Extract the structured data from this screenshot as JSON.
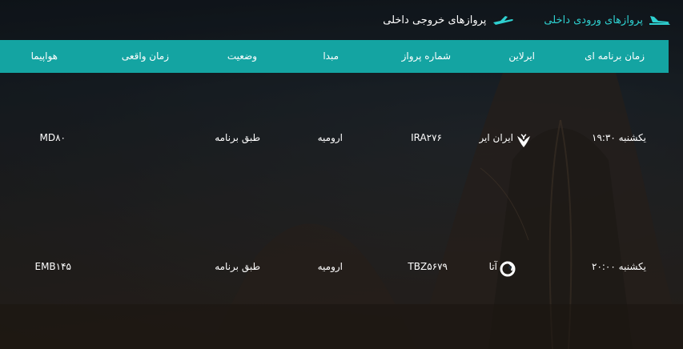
{
  "tabs": [
    {
      "label": "پروازهای ورودی داخلی",
      "icon": "plane-landing-icon",
      "active": true
    },
    {
      "label": "پروازهای خروجی داخلی",
      "icon": "plane-takeoff-icon",
      "active": false
    }
  ],
  "colors": {
    "accent": "#14a4a2",
    "active_tab": "#2ed0d0"
  },
  "columns": [
    "زمان برنامه ای",
    "ایرلاین",
    "شماره پرواز",
    "مبدا",
    "وضعیت",
    "زمان واقعی",
    "هواپیما"
  ],
  "rows": [
    {
      "time": "یکشنبه ۱۹:۳۰",
      "airline": "ایران ایر",
      "airline_logo": "iran-air-logo",
      "flight": "IRA۲۷۶",
      "origin": "ارومیه",
      "status": "طبق برنامه",
      "actual": "",
      "aircraft": "MD۸۰"
    },
    {
      "time": "یکشنبه ۲۰:۰۰",
      "airline": "آتا",
      "airline_logo": "ata-logo",
      "flight": "TBZ۵۶۷۹",
      "origin": "ارومیه",
      "status": "طبق برنامه",
      "actual": "",
      "aircraft": "EMB۱۴۵"
    }
  ]
}
